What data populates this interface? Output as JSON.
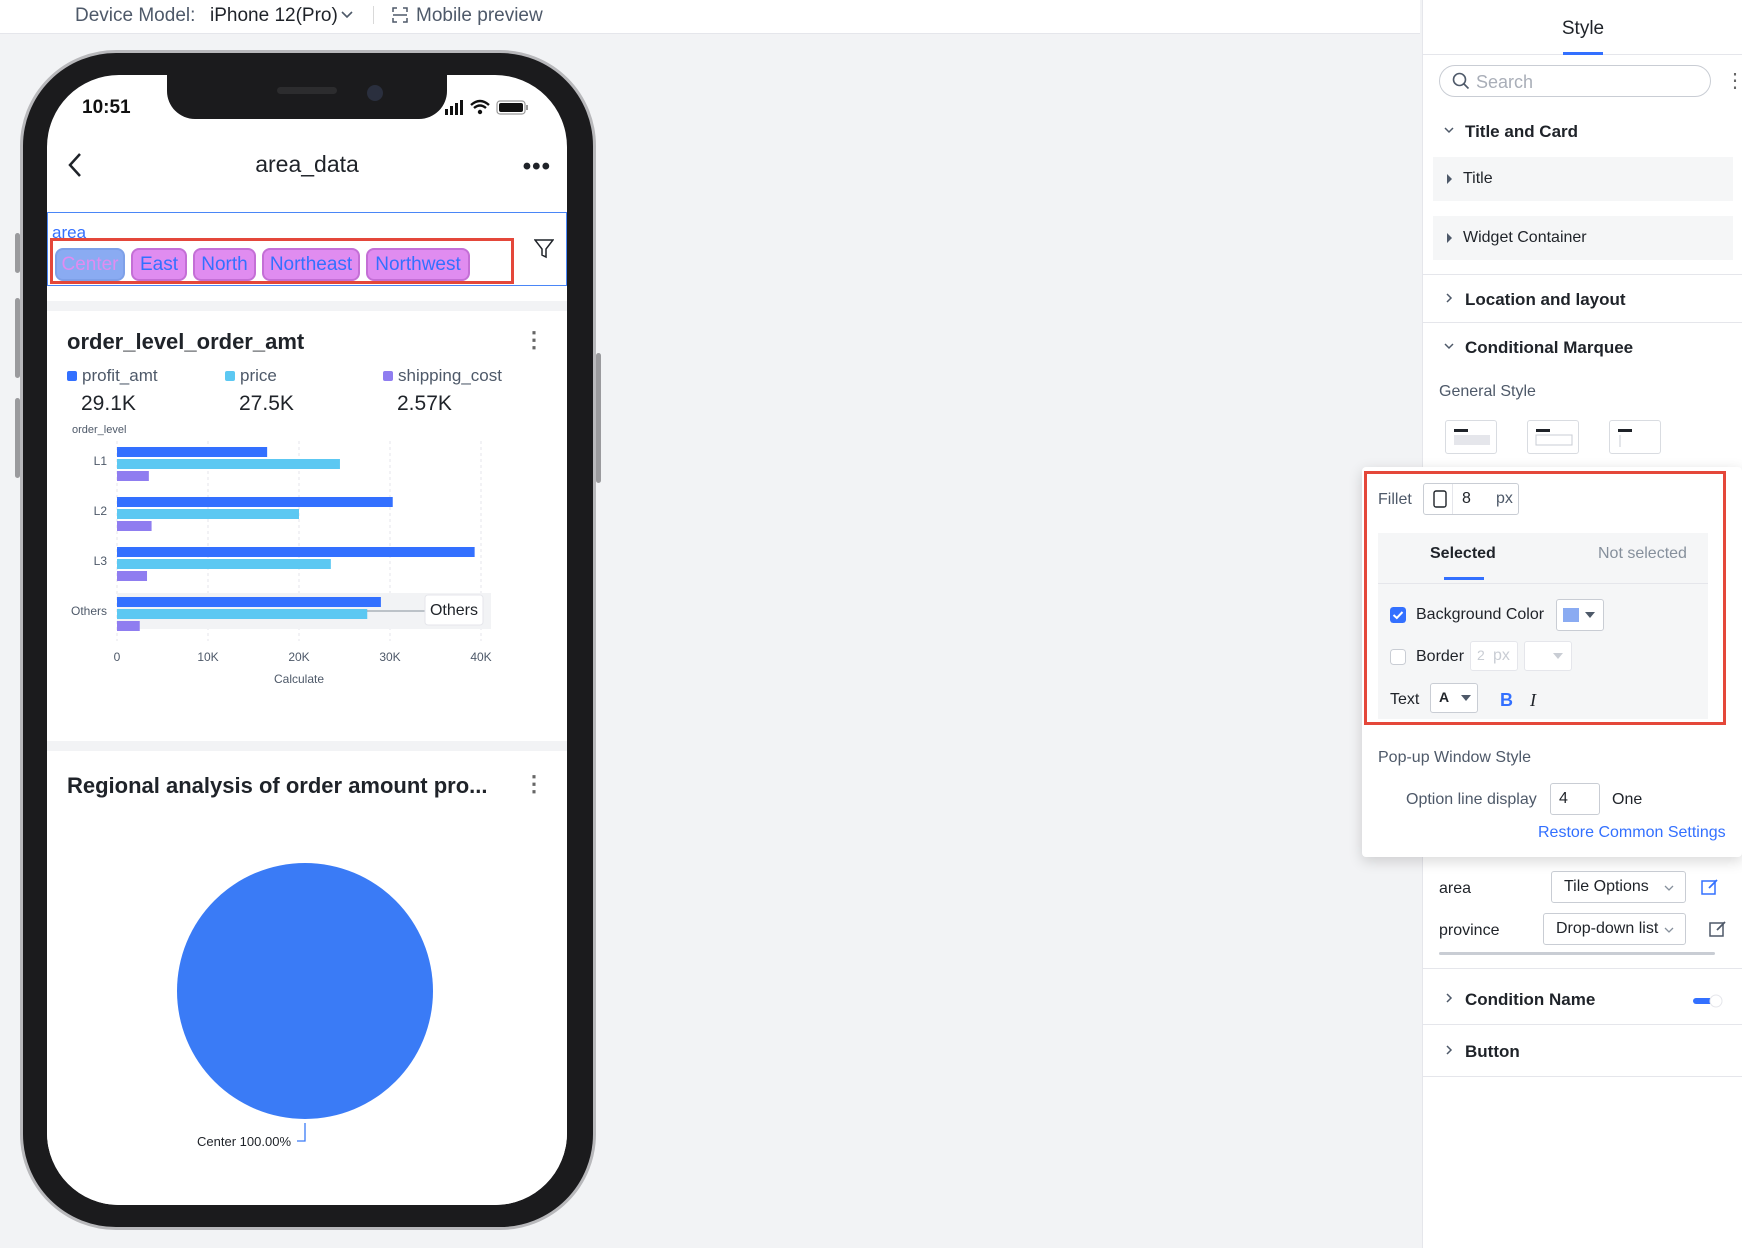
{
  "topbar": {
    "device_label": "Device Model:",
    "device_value": "iPhone 12(Pro)",
    "mobile_preview": "Mobile preview"
  },
  "phone": {
    "time": "10:51",
    "title": "area_data",
    "more": "•••",
    "filter": {
      "label": "area",
      "chips": [
        "Center",
        "East",
        "North",
        "Northeast",
        "Northwest"
      ],
      "selected": "Center"
    },
    "card1": {
      "title": "order_level_order_amt",
      "more": "⋮",
      "metrics": [
        {
          "label": "profit_amt",
          "value": "29.1K",
          "color": "#3370ff"
        },
        {
          "label": "price",
          "value": "27.5K",
          "color": "#5cc8f2"
        },
        {
          "label": "shipping_cost",
          "value": "2.57K",
          "color": "#8f7df0"
        }
      ]
    },
    "card2": {
      "title": "Regional analysis of order amount pro...",
      "more": "⋮"
    }
  },
  "chart_data": [
    {
      "type": "bar",
      "orientation": "horizontal",
      "categories": [
        "L1",
        "L2",
        "L3",
        "Others"
      ],
      "series": [
        {
          "name": "profit_amt",
          "values": [
            16500,
            30300,
            39300,
            29000
          ],
          "color": "#3370ff"
        },
        {
          "name": "price",
          "values": [
            24500,
            20000,
            23500,
            27500
          ],
          "color": "#5cc8f2"
        },
        {
          "name": "shipping_cost",
          "values": [
            3500,
            3800,
            3300,
            2500
          ],
          "color": "#8f7df0"
        }
      ],
      "ylabel": "order_level",
      "xlabel": "Calculate",
      "xticks": [
        "0",
        "10K",
        "20K",
        "30K",
        "40K"
      ],
      "xlim": [
        0,
        40000
      ],
      "tooltip": "Others",
      "grid": "vertical dashed"
    },
    {
      "type": "pie",
      "slices": [
        {
          "label": "Center",
          "value": 100,
          "color": "#3a7bf6"
        }
      ],
      "data_label": "Center 100.00%"
    }
  ],
  "panel": {
    "tab": "Style",
    "search_placeholder": "Search",
    "sections": {
      "title_and_card": "Title and Card",
      "title": "Title",
      "widget_container": "Widget Container",
      "location_layout": "Location and layout",
      "conditional_marquee": "Conditional Marquee",
      "general_style": "General Style",
      "condition_name": "Condition Name",
      "button": "Button"
    },
    "rows": [
      {
        "label": "area",
        "value": "Tile Options"
      },
      {
        "label": "province",
        "value": "Drop-down list"
      }
    ]
  },
  "popup": {
    "fillet_label": "Fillet",
    "fillet_value": "8",
    "fillet_unit": "px",
    "tab_selected": "Selected",
    "tab_not_selected": "Not selected",
    "bg_color_label": "Background Color",
    "bg_color_checked": true,
    "bg_color_value": "#8aabf2",
    "border_label": "Border",
    "border_value": "2",
    "border_unit": "px",
    "text_label": "Text",
    "text_font": "A",
    "bold": "B",
    "italic": "I",
    "popup_style_label": "Pop-up Window Style",
    "option_line_label": "Option line display",
    "option_line_value": "4",
    "option_line_unit": "One",
    "restore": "Restore Common Settings"
  }
}
